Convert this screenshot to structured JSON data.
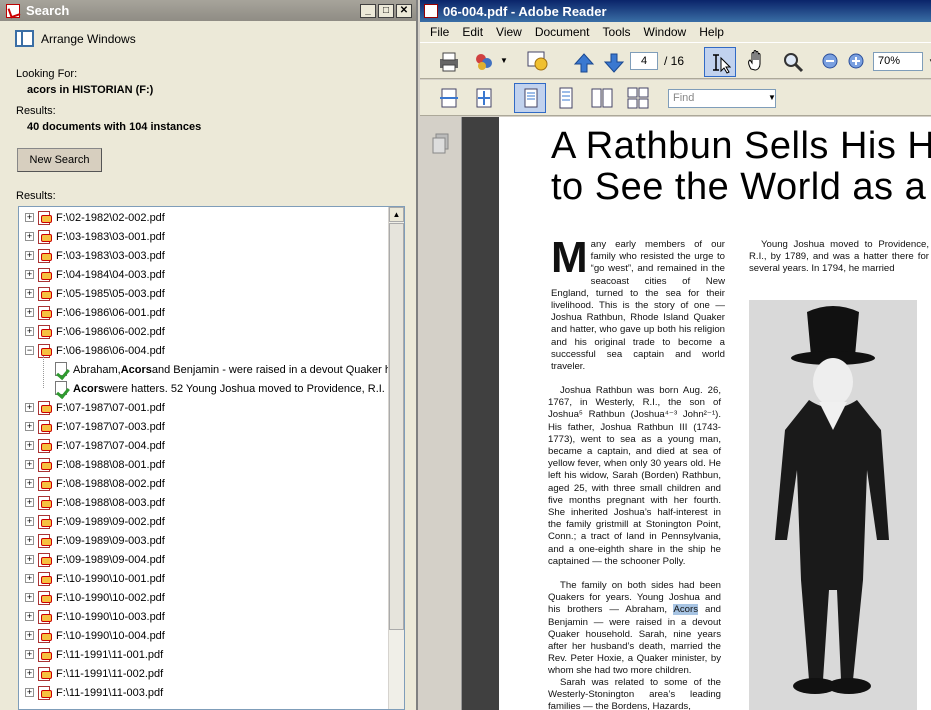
{
  "search": {
    "title": "Search",
    "window_buttons": [
      "_",
      "□",
      "✕"
    ],
    "arrange_windows": "Arrange Windows",
    "looking_for_label": "Looking For:",
    "looking_for_value": "acors in HISTORIAN (F:)",
    "results_label": "Results:",
    "results_value": "40 documents with 104 instances",
    "new_search": "New Search",
    "results_list_label": "Results:",
    "files_before": [
      "F:\\02-1982\\02-002.pdf",
      "F:\\03-1983\\03-001.pdf",
      "F:\\03-1983\\03-003.pdf",
      "F:\\04-1984\\04-003.pdf",
      "F:\\05-1985\\05-003.pdf",
      "F:\\06-1986\\06-001.pdf",
      "F:\\06-1986\\06-002.pdf",
      "F:\\06-1986\\06-004.pdf"
    ],
    "hits": [
      {
        "pre": "Abraham, ",
        "match": "Acors",
        "post": " and Benjamin - were raised in a devout Quaker h"
      },
      {
        "pre": "",
        "match": "Acors",
        "post": " were hatters. 52 Young Joshua moved to Providence, R.I."
      }
    ],
    "files_after": [
      "F:\\07-1987\\07-001.pdf",
      "F:\\07-1987\\07-003.pdf",
      "F:\\07-1987\\07-004.pdf",
      "F:\\08-1988\\08-001.pdf",
      "F:\\08-1988\\08-002.pdf",
      "F:\\08-1988\\08-003.pdf",
      "F:\\09-1989\\09-002.pdf",
      "F:\\09-1989\\09-003.pdf",
      "F:\\09-1989\\09-004.pdf",
      "F:\\10-1990\\10-001.pdf",
      "F:\\10-1990\\10-002.pdf",
      "F:\\10-1990\\10-003.pdf",
      "F:\\10-1990\\10-004.pdf",
      "F:\\11-1991\\11-001.pdf",
      "F:\\11-1991\\11-002.pdf",
      "F:\\11-1991\\11-003.pdf"
    ]
  },
  "reader": {
    "title": "06-004.pdf - Adobe Reader",
    "menu": [
      "File",
      "Edit",
      "View",
      "Document",
      "Tools",
      "Window",
      "Help"
    ],
    "page_current": "4",
    "page_total": "/ 16",
    "zoom": "70%",
    "find_placeholder": "Find"
  },
  "article": {
    "headline_line1": "A Rathbun Sells His H",
    "headline_line2": "to See the World as a",
    "dropcap": "M",
    "para1": "any early members of our family who resisted the urge to “go west”, and remained in the seacoast cities of New England, turned to the sea for their livelihood. This is the story of one — Joshua Rathbun, Rhode Island Quaker and hatter, who gave up both his religion and his original trade to become a successful sea captain and world traveler.",
    "para2": "Joshua Rathbun was born Aug. 26, 1767, in Westerly, R.I., the son of Joshua⁵ Rathbun (Joshua⁴⁻³ John²⁻¹). His father, Joshua Rathbun III (1743-1773), went to sea as a young man, became a captain, and died at sea of yellow fever, when only 30 years old. He left his widow, Sarah (Borden) Rathbun, aged 25, with three small children and five months pregnant with her fourth. She inherited Joshua’s half-interest in the family gristmill at Stonington Point, Conn.; a tract of land in Pennsylvania, and a one-eighth share in the ship he captained — the schooner Polly.",
    "para3_pre": "The family on both sides had been Quakers for years. Young Joshua and his brothers — Abraham, ",
    "para3_match": "Acors",
    "para3_post": " and Benjamin — were raised in a devout Quaker household. Sarah, nine years after her husband’s death, married the Rev. Peter Hoxie, a Quaker minister, by whom she had two more children.",
    "para4": "Sarah was related to some of the Westerly-Stonington area’s leading families — the Bordens, Hazards,",
    "col2_text": "Young Joshua moved to Providence, R.I., by 1789, and was a hatter there for several years. In 1794, he married"
  }
}
